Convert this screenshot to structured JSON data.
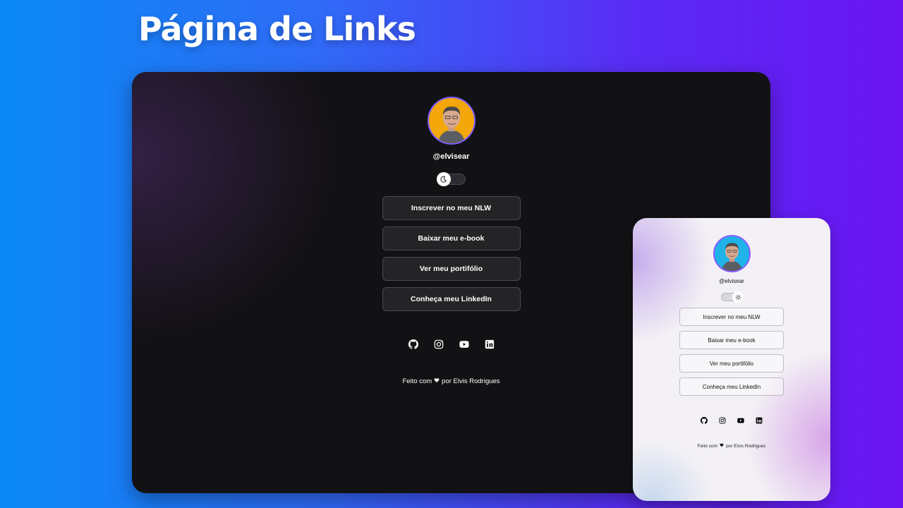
{
  "page": {
    "title": "Página de Links"
  },
  "profile": {
    "username": "@elvisear"
  },
  "links": [
    {
      "label": "Inscrever no meu NLW"
    },
    {
      "label": "Baixar meu e-book"
    },
    {
      "label": "Ver meu portifólio"
    },
    {
      "label": "Conheça meu LinkedIn"
    }
  ],
  "socials": [
    {
      "icon": "github-icon"
    },
    {
      "icon": "instagram-icon"
    },
    {
      "icon": "youtube-icon"
    },
    {
      "icon": "linkedin-icon"
    }
  ],
  "footer": {
    "prefix": "Feito com",
    "suffix": "por Elvis Rodrigues"
  },
  "theme": {
    "dark_mode_toggle": "on",
    "light_mode_toggle": "on"
  },
  "colors": {
    "dark_bg": "#121114",
    "light_bg": "#f3f1f5",
    "avatar_border": "#7c5cff",
    "avatar_bg_dark": "#f3a70a",
    "avatar_bg_light": "#1fb3e8"
  }
}
